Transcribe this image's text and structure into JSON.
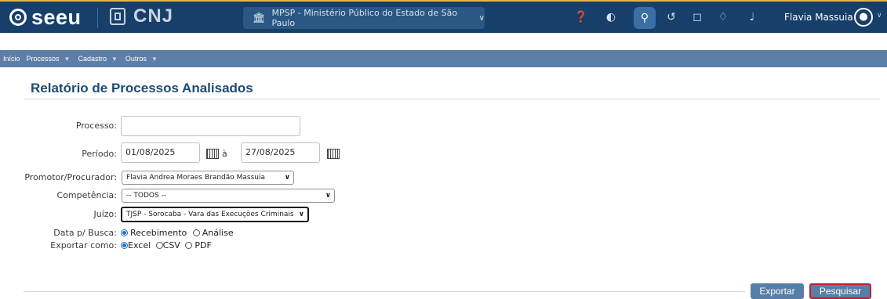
{
  "header": {
    "logo_text": "seeu",
    "cnj_text": "CNJ",
    "org_selector": "MPSP - Ministério Público do Estado de São Paulo",
    "user_name": "Flavia Massuia"
  },
  "menu": {
    "items": [
      {
        "label": "Início"
      },
      {
        "label": "Processos"
      },
      {
        "label": "Cadastro"
      },
      {
        "label": "Outros"
      }
    ]
  },
  "page": {
    "title": "Relatório de Processos Analisados"
  },
  "form": {
    "processo_label": "Processo:",
    "processo_value": "",
    "periodo_label": "Período:",
    "periodo_start": "01/08/2025",
    "periodo_separator": "à",
    "periodo_end": "27/08/2025",
    "promotor_label": "Promotor/Procurador:",
    "promotor_value": "Flavia Andrea Moraes Brandão Massuia",
    "competencia_label": "Competência:",
    "competencia_value": "-- TODOS --",
    "juizo_label": "Juízo:",
    "juizo_value": "TJSP - Sorocaba - Vara das Execuções Criminais",
    "data_busca_label": "Data p/ Busca:",
    "data_busca_options": [
      {
        "label": "Recebimento",
        "selected": true
      },
      {
        "label": "Análise",
        "selected": false
      }
    ],
    "exportar_label": "Exportar como:",
    "exportar_options": [
      {
        "label": "Excel",
        "selected": true
      },
      {
        "label": "CSV",
        "selected": false
      },
      {
        "label": "PDF",
        "selected": false
      }
    ]
  },
  "buttons": {
    "exportar": "Exportar",
    "pesquisar": "Pesquisar"
  },
  "colors": {
    "header_bg": "#163f69",
    "menu_bg": "#5d7fa7",
    "title": "#1e4a75",
    "button_bg": "#577ea7",
    "highlight_border": "#c1202a"
  },
  "icons": {
    "logo": "seeu-logo-icon",
    "cnj": "cnj-logo-icon",
    "org": "bank-icon",
    "help": "help-icon",
    "contrast": "contrast-icon",
    "search": "search-icon",
    "history": "history-icon",
    "bookmark": "bookmark-icon",
    "tag": "tag-icon",
    "bell": "bell-icon",
    "user": "user-avatar-icon",
    "calendar": "calendar-icon"
  }
}
